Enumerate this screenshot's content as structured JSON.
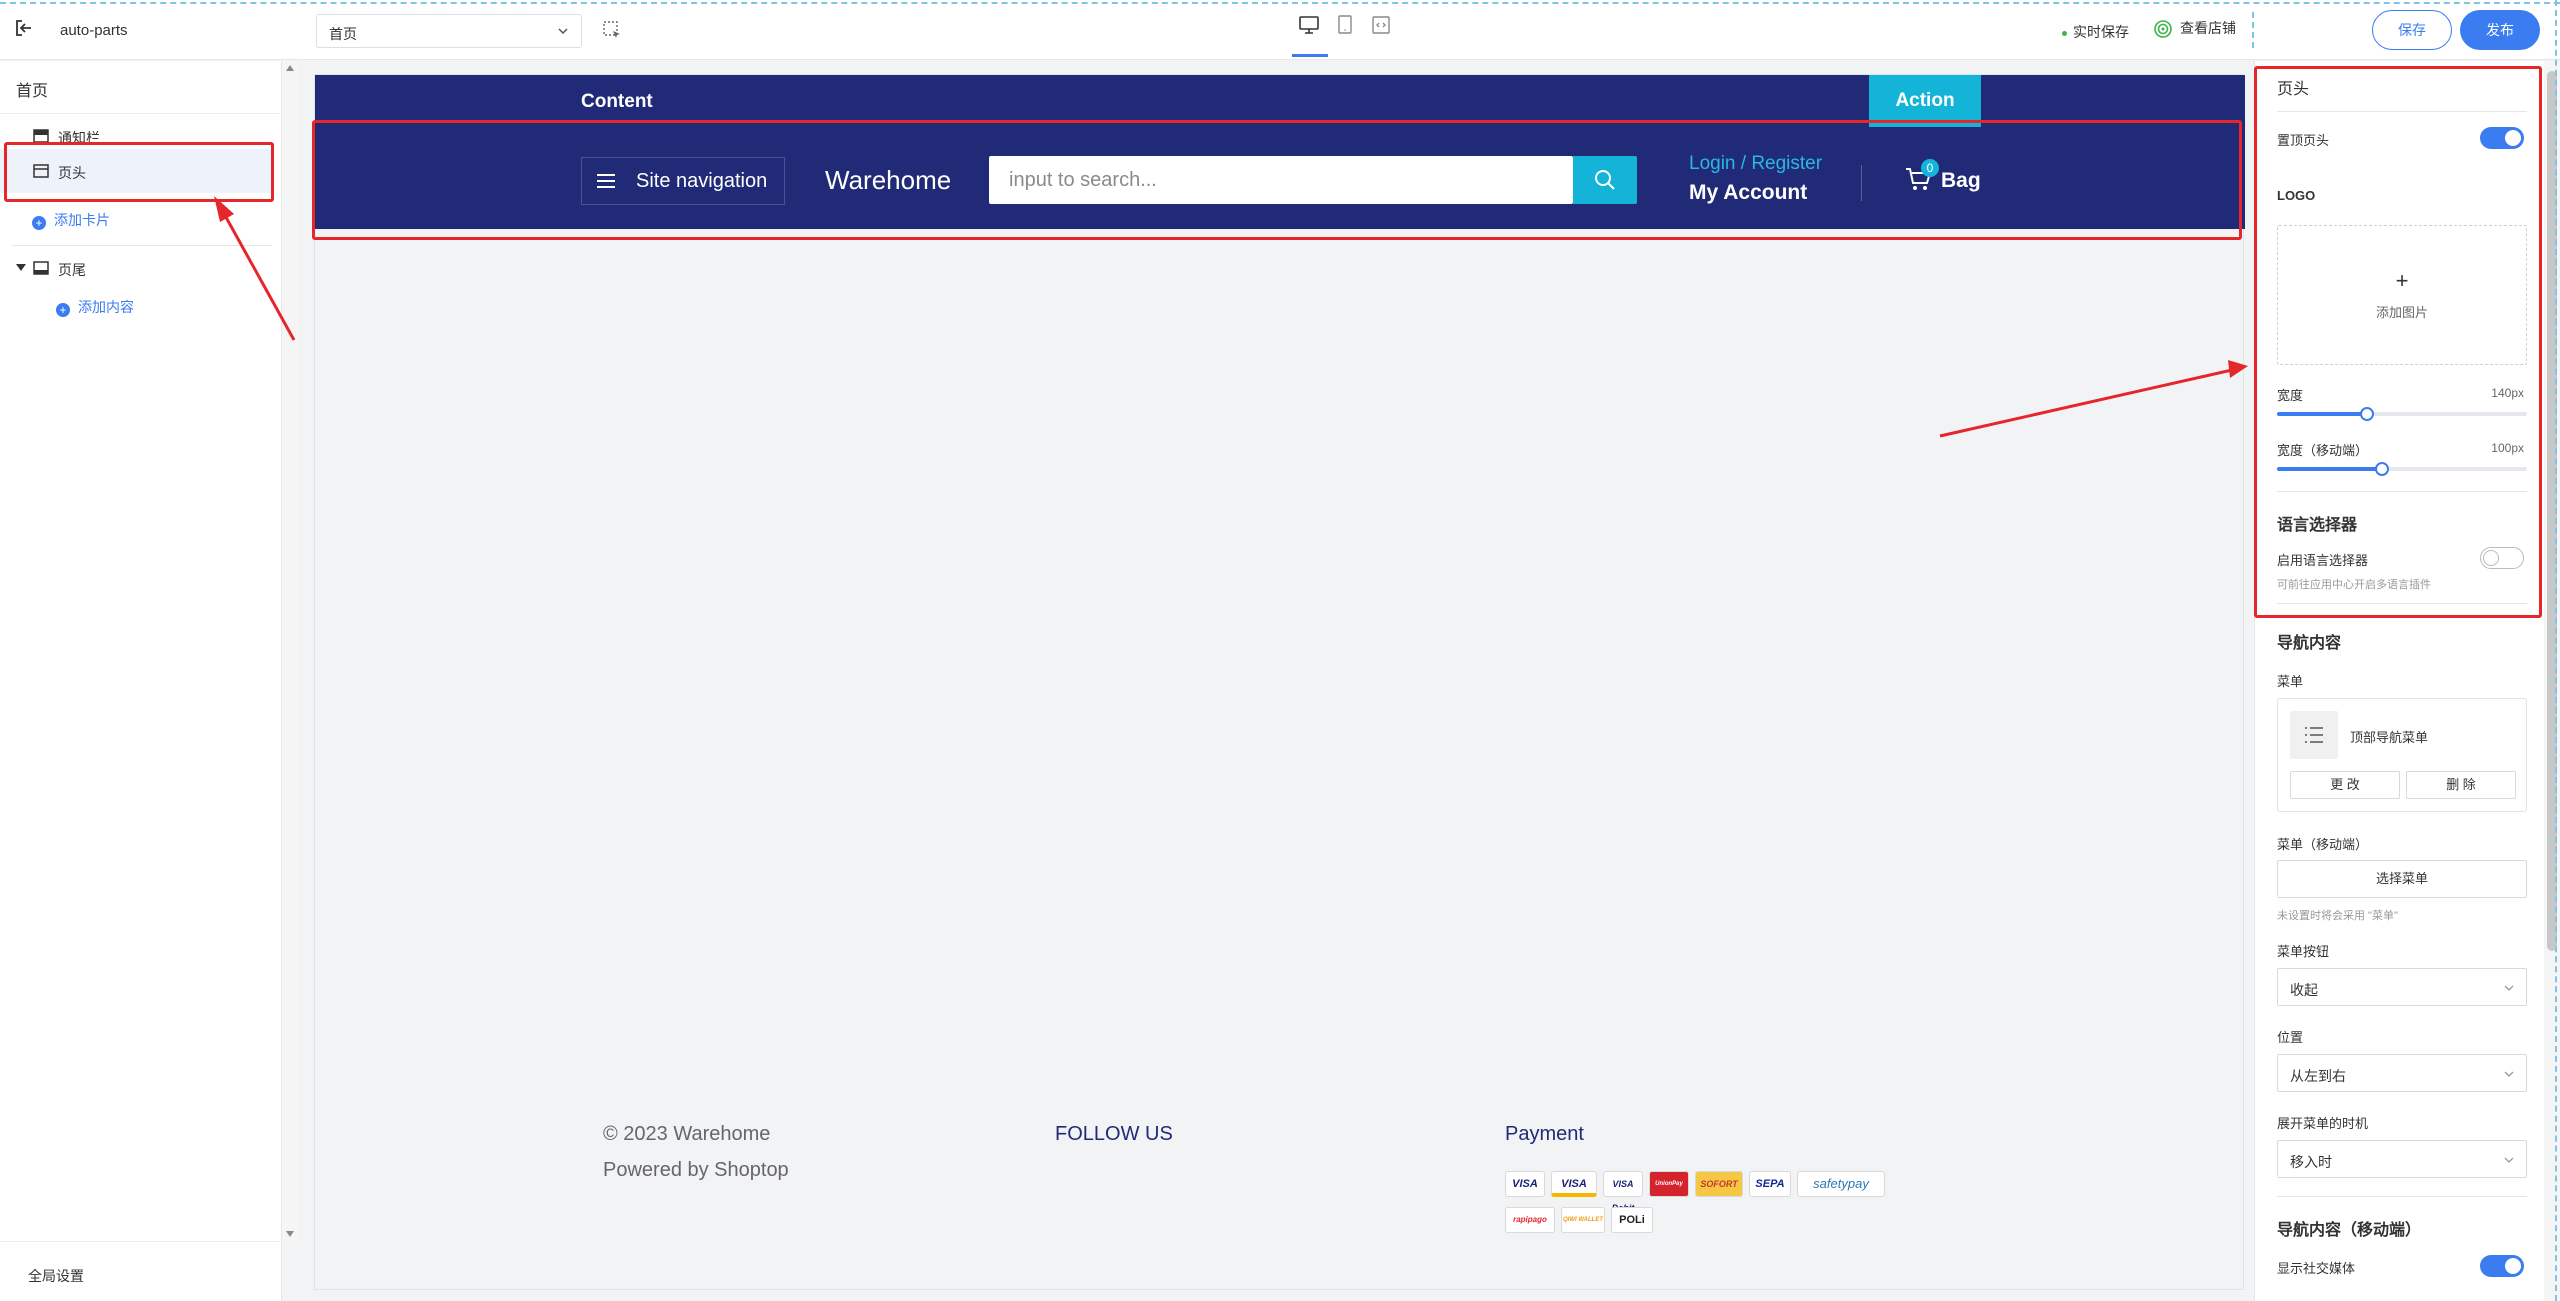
{
  "topbar": {
    "app_name": "auto-parts",
    "page_select_value": "首页",
    "realtime_save": "实时保存",
    "view_store": "查看店铺",
    "save_button": "保存",
    "publish_button": "发布",
    "devices": [
      "desktop-icon",
      "tablet-icon",
      "code-icon"
    ],
    "accent_color": "#3b7cf0"
  },
  "sidebar": {
    "title": "首页",
    "items": [
      {
        "label": "通知栏",
        "icon": "notice-bar-icon"
      },
      {
        "label": "页头",
        "icon": "header-icon",
        "selected": true
      },
      {
        "label": "添加卡片",
        "type": "add"
      },
      {
        "label": "页尾",
        "icon": "footer-icon",
        "expanded": true
      },
      {
        "label": "添加内容",
        "type": "add"
      }
    ],
    "global_settings": "全局设置"
  },
  "preview": {
    "notice_bar": {
      "content": "Content",
      "action": "Action"
    },
    "header": {
      "site_nav": "Site navigation",
      "brand": "Warehome",
      "search_placeholder": "input to search...",
      "login_register": "Login / Register",
      "my_account": "My Account",
      "bag_label": "Bag",
      "bag_count": "0"
    },
    "footer": {
      "copyright": "© 2023 Warehome",
      "powered": "Powered by Shoptop",
      "follow_us": "FOLLOW US",
      "payment_title": "Payment",
      "payment_methods_row1": [
        "VISA",
        "VISA",
        "VISA Debit",
        "UnionPay",
        "SOFORT",
        "SEPA",
        "safetypay"
      ],
      "payment_methods_row2": [
        "rapipago",
        "QIWI WALLET",
        "POLi"
      ]
    },
    "colors": {
      "navy": "#202a76",
      "cyan": "#13b4d8"
    }
  },
  "panel": {
    "title": "页头",
    "sticky_header": {
      "label": "置顶页头",
      "on": true
    },
    "logo": {
      "section": "LOGO",
      "upload_label": "添加图片",
      "upload_plus": "+"
    },
    "width": {
      "label": "宽度",
      "value": "140px",
      "level": 0.36
    },
    "width_mobile": {
      "label": "宽度（移动端）",
      "value": "100px",
      "level": 0.42
    },
    "language": {
      "section": "语言选择器",
      "toggle_label": "启用语言选择器",
      "on": false,
      "hint": "可前往应用中心开启多语言插件"
    },
    "nav_content": {
      "section": "导航内容",
      "menu_label": "菜单",
      "menu_name": "顶部导航菜单",
      "change": "更 改",
      "delete": "删 除",
      "mobile_menu_label": "菜单（移动端）",
      "choose_menu": "选择菜单",
      "mobile_hint": "未设置时将会采用 \"菜单\"",
      "menu_button_label": "菜单按钮",
      "menu_button_value": "收起",
      "position_label": "位置",
      "position_value": "从左到右",
      "expand_timing_label": "展开菜单的时机",
      "expand_timing_value": "移入时"
    },
    "nav_mobile": {
      "section": "导航内容（移动端）",
      "social_label": "显示社交媒体",
      "social_on": true
    }
  },
  "annotation_color": "#e5262a"
}
